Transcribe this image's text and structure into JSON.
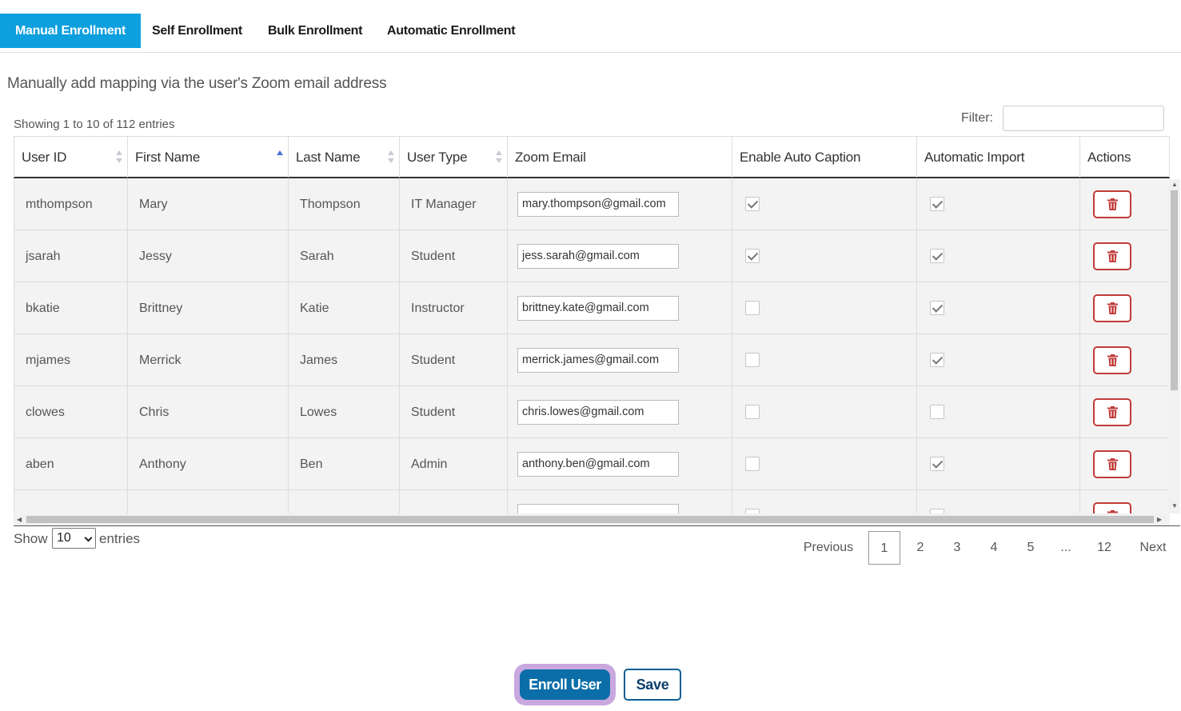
{
  "tabs": [
    {
      "label": "Manual Enrollment",
      "active": true
    },
    {
      "label": "Self Enrollment"
    },
    {
      "label": "Bulk Enrollment"
    },
    {
      "label": "Automatic Enrollment"
    }
  ],
  "subtitle": "Manually add mapping via the user's Zoom email address",
  "info": "Showing 1 to 10 of 112 entries",
  "filter": {
    "label": "Filter:",
    "value": ""
  },
  "table": {
    "columns": [
      "User ID",
      "First Name",
      "Last Name",
      "User Type",
      "Zoom Email",
      "Enable Auto Caption",
      "Automatic Import",
      "Actions"
    ],
    "sorted_column": "First Name",
    "rows": [
      {
        "user_id": "mthompson",
        "first": "Mary",
        "last": "Thompson",
        "type": "IT Manager",
        "email": "mary.thompson@gmail.com",
        "caption": true,
        "import": true
      },
      {
        "user_id": "jsarah",
        "first": "Jessy",
        "last": "Sarah",
        "type": "Student",
        "email": "jess.sarah@gmail.com",
        "caption": true,
        "import": true
      },
      {
        "user_id": "bkatie",
        "first": "Brittney",
        "last": "Katie",
        "type": "Instructor",
        "email": "brittney.kate@gmail.com",
        "caption": false,
        "import": true
      },
      {
        "user_id": "mjames",
        "first": "Merrick",
        "last": "James",
        "type": "Student",
        "email": "merrick.james@gmail.com",
        "caption": false,
        "import": true
      },
      {
        "user_id": "clowes",
        "first": "Chris",
        "last": "Lowes",
        "type": "Student",
        "email": "chris.lowes@gmail.com",
        "caption": false,
        "import": false
      },
      {
        "user_id": "aben",
        "first": "Anthony",
        "last": "Ben",
        "type": "Admin",
        "email": "anthony.ben@gmail.com",
        "caption": false,
        "import": true
      }
    ],
    "delete_icon": "trash-icon"
  },
  "length": {
    "show_label": "Show",
    "value": "10",
    "entries_label": "entries"
  },
  "pagination": {
    "previous": "Previous",
    "pages": [
      "1",
      "2",
      "3",
      "4",
      "5",
      "...",
      "12"
    ],
    "current": "1",
    "next": "Next"
  },
  "buttons": {
    "enroll": "Enroll User",
    "save": "Save"
  },
  "colors": {
    "accent": "#0e9fde",
    "primary_button": "#0b6ea8",
    "danger": "#c23a3a",
    "focus_ring": "#c9a7df"
  }
}
